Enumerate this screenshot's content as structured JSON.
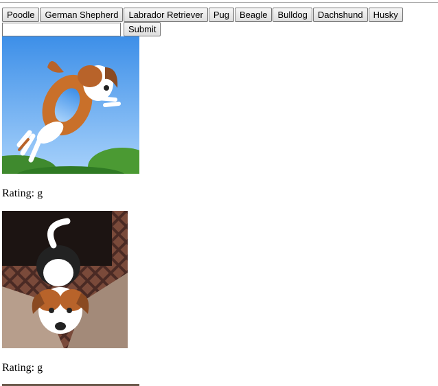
{
  "breed_buttons": [
    {
      "label": "Poodle"
    },
    {
      "label": "German Shepherd"
    },
    {
      "label": "Labrador Retriever"
    },
    {
      "label": "Pug"
    },
    {
      "label": "Beagle"
    },
    {
      "label": "Bulldog"
    },
    {
      "label": "Dachshund"
    },
    {
      "label": "Husky"
    }
  ],
  "search": {
    "value": "",
    "placeholder": "",
    "submit_label": "Submit"
  },
  "results": [
    {
      "rating_text": "Rating: g",
      "image_semantic": "beagle-flying-with-donut-gif"
    },
    {
      "rating_text": "Rating: g",
      "image_semantic": "beagle-on-couch-gif"
    }
  ],
  "colors": {
    "sky": "#5aa6f0",
    "grass": "#3f8a2e",
    "room": "#3a2a24",
    "couch": "#b79e8c"
  }
}
